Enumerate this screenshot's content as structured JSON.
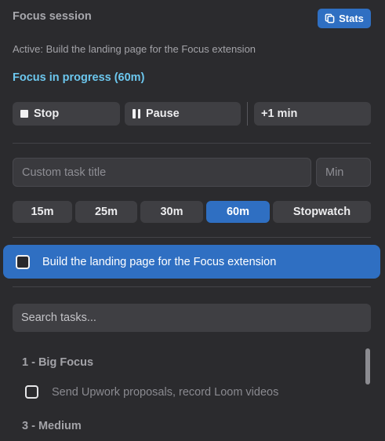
{
  "header": {
    "title": "Focus session",
    "stats_label": "Stats",
    "stats_icon": "copy-icon"
  },
  "session": {
    "active_text": "Active: Build the landing page for the Focus extension",
    "status_text": "Focus in progress (60m)"
  },
  "controls": {
    "stop_label": "Stop",
    "pause_label": "Pause",
    "add_minute_label": "+1 min"
  },
  "custom_task": {
    "title_placeholder": "Custom task title",
    "min_placeholder": "Min"
  },
  "presets": [
    {
      "label": "15m",
      "active": false
    },
    {
      "label": "25m",
      "active": false
    },
    {
      "label": "30m",
      "active": false
    },
    {
      "label": "60m",
      "active": true
    },
    {
      "label": "Stopwatch",
      "active": false
    }
  ],
  "current_task": {
    "label": "Build the landing page for the Focus extension",
    "checked": false
  },
  "search": {
    "placeholder": "Search tasks..."
  },
  "task_groups": [
    {
      "heading": "1 - Big Focus",
      "tasks": [
        {
          "label": "Send Upwork proposals, record Loom videos",
          "checked": false
        }
      ]
    },
    {
      "heading": "3 - Medium",
      "tasks": []
    }
  ],
  "colors": {
    "background": "#2b2b2e",
    "accent": "#2f6fc2",
    "status_text": "#6cc7ee",
    "button_bg": "#3f3f43"
  }
}
